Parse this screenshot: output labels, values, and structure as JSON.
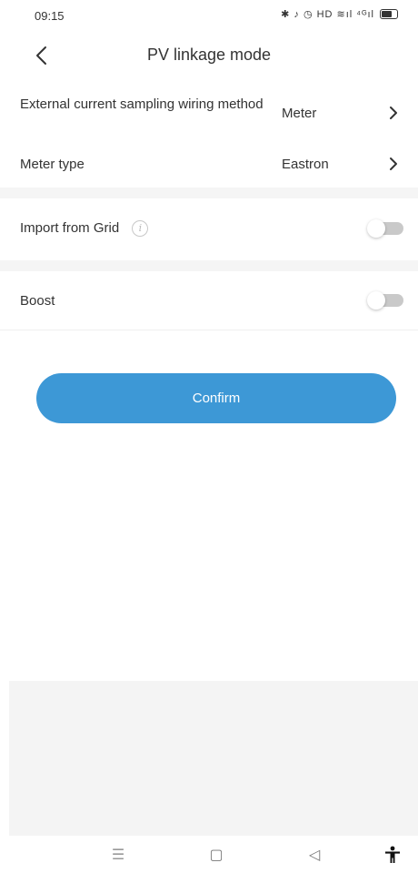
{
  "status_bar": {
    "time": "09:15",
    "icons_text": "✱ ♪ ◷ HD ≋ıl ⁴ᴳıl"
  },
  "header": {
    "title": "PV linkage mode"
  },
  "rows": {
    "sampling": {
      "label": "External current sampling wiring method",
      "value": "Meter"
    },
    "meter_type": {
      "label": "Meter type",
      "value": "Eastron"
    },
    "import_from_grid": {
      "label": "Import from Grid",
      "info_glyph": "i",
      "enabled": false
    },
    "boost": {
      "label": "Boost",
      "enabled": false
    }
  },
  "confirm": {
    "label": "Confirm"
  },
  "nav": {
    "menu_glyph": "☰",
    "home_glyph": "▢",
    "back_glyph": "◁"
  },
  "colors": {
    "accent": "#3d98d6",
    "toggle_off": "#c9c9c9",
    "separator": "#f5f5f5"
  }
}
